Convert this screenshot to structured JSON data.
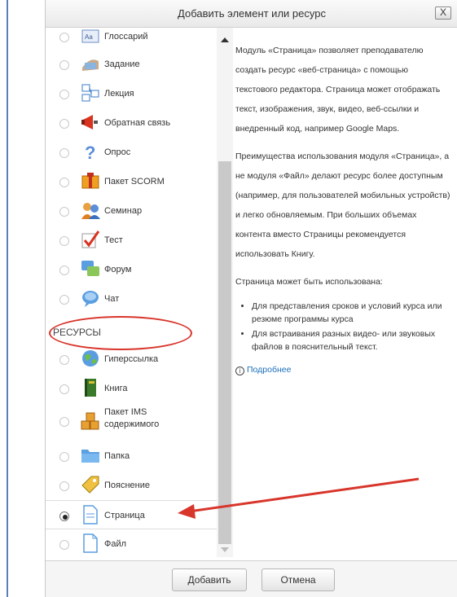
{
  "dialog": {
    "title": "Добавить элемент или ресурс",
    "close_label": "X",
    "add_button": "Добавить",
    "cancel_button": "Отмена"
  },
  "activities": [
    {
      "label": "Глоссарий",
      "icon": "glossary-icon"
    },
    {
      "label": "Задание",
      "icon": "assignment-icon"
    },
    {
      "label": "Лекция",
      "icon": "lesson-icon"
    },
    {
      "label": "Обратная связь",
      "icon": "feedback-icon"
    },
    {
      "label": "Опрос",
      "icon": "choice-icon"
    },
    {
      "label": "Пакет SCORM",
      "icon": "scorm-icon"
    },
    {
      "label": "Семинар",
      "icon": "workshop-icon"
    },
    {
      "label": "Тест",
      "icon": "quiz-icon"
    },
    {
      "label": "Форум",
      "icon": "forum-icon"
    },
    {
      "label": "Чат",
      "icon": "chat-icon"
    }
  ],
  "resources_heading": "РЕСУРСЫ",
  "resources": [
    {
      "label": "Гиперссылка",
      "icon": "url-icon"
    },
    {
      "label": "Книга",
      "icon": "book-icon"
    },
    {
      "label_line1": "Пакет IMS",
      "label_line2": "содержимого",
      "icon": "ims-package-icon"
    },
    {
      "label": "Папка",
      "icon": "folder-icon"
    },
    {
      "label": "Пояснение",
      "icon": "label-icon"
    },
    {
      "label": "Страница",
      "icon": "page-icon",
      "selected": true
    },
    {
      "label": "Файл",
      "icon": "file-icon"
    }
  ],
  "description": {
    "p1": "Модуль «Страница» позволяет преподавателю создать ресурс «веб-страница» с помощью текстового редактора. Страница может отображать текст, изображения, звук, видео, веб-ссылки и внедренный код, например Google Maps.",
    "p2": "Преимущества использования модуля «Страница», а не модуля «Файл» делают ресурс более доступным (например, для пользователей мобильных устройств) и легко обновляемым. При больших объемах контента вместо Страницы рекомендуется использовать Книгу.",
    "p3": "Страница может быть использована:",
    "bullets": [
      "Для представления сроков и условий курса или резюме программы курса",
      "Для встраивания разных видео- или звуковых файлов в пояснительный текст."
    ],
    "more_link": "Подробнее"
  },
  "colors": {
    "annotation": "#d8352b",
    "link": "#1a6fba"
  }
}
